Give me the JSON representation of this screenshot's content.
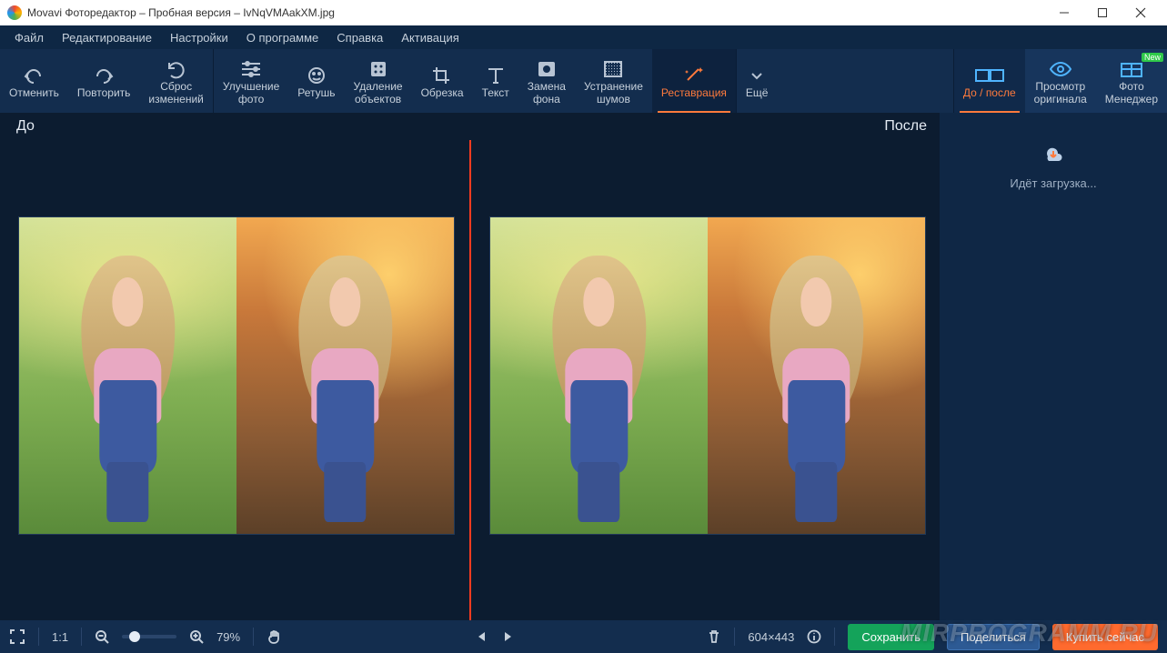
{
  "window": {
    "title": "Movavi Фоторедактор – Пробная версия – IvNqVMAakXM.jpg",
    "minimize_tip": "Minimize",
    "maximize_tip": "Maximize",
    "close_tip": "Close"
  },
  "menu": {
    "file": "Файл",
    "edit": "Редактирование",
    "settings": "Настройки",
    "about": "О программе",
    "help": "Справка",
    "activation": "Активация"
  },
  "toolbar": {
    "undo": "Отменить",
    "redo": "Повторить",
    "reset_l1": "Сброс",
    "reset_l2": "изменений",
    "enhance_l1": "Улучшение",
    "enhance_l2": "фото",
    "retouch": "Ретушь",
    "remove_l1": "Удаление",
    "remove_l2": "объектов",
    "crop": "Обрезка",
    "text": "Текст",
    "bg_l1": "Замена",
    "bg_l2": "фона",
    "noise_l1": "Устранение",
    "noise_l2": "шумов",
    "restoration": "Реставрация",
    "more": "Ещё",
    "before_after": "До / после",
    "preview_l1": "Просмотр",
    "preview_l2": "оригинала",
    "manager_l1": "Фото",
    "manager_l2": "Менеджер",
    "new_badge": "New"
  },
  "canvas": {
    "before_label": "До",
    "after_label": "После"
  },
  "sidepanel": {
    "loading_text": "Идёт загрузка..."
  },
  "statusbar": {
    "zoom_ratio": "1:1",
    "zoom_pct": "79%",
    "dimensions": "604×443",
    "save": "Сохранить",
    "share": "Поделиться",
    "buy": "Купить сейчас"
  },
  "watermark": "MIRPROGRAMM.RU"
}
